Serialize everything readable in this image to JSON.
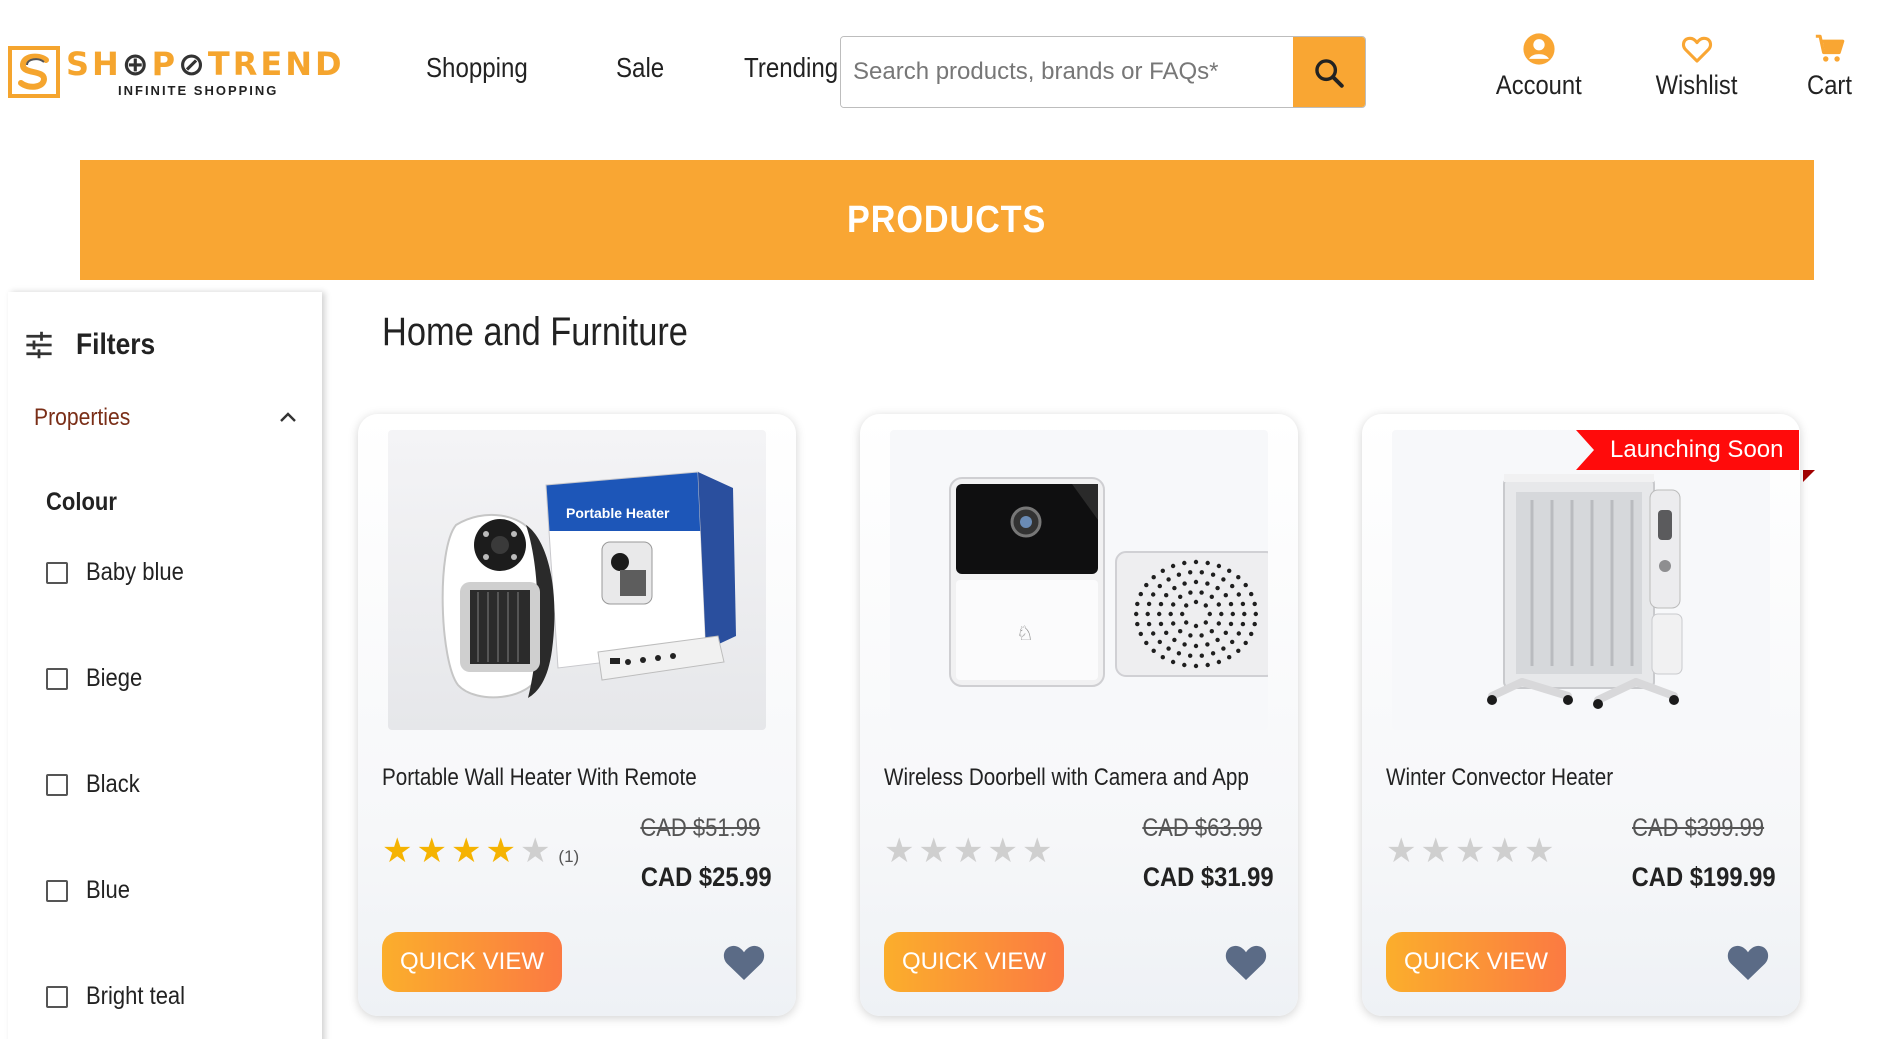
{
  "header": {
    "logo": {
      "name_left": "SH",
      "name_rest": "P",
      "name_mid": "T",
      "name_end": "REND",
      "tagline": "INFINITE SHOPPING"
    },
    "nav": [
      "Shopping",
      "Sale",
      "Trending"
    ],
    "search": {
      "placeholder": "Search products, brands or FAQs*",
      "icon": "search-icon"
    },
    "actions": {
      "account": "Account",
      "wishlist": "Wishlist",
      "cart": "Cart"
    }
  },
  "banner": {
    "title": "PRODUCTS"
  },
  "sidebar": {
    "title": "Filters",
    "properties_label": "Properties",
    "colour_title": "Colour",
    "colours": [
      "Baby blue",
      "Biege",
      "Black",
      "Blue",
      "Bright teal"
    ]
  },
  "main": {
    "section_title": "Home and Furniture",
    "products": [
      {
        "name": "Portable Wall Heater With Remote",
        "rating": 4,
        "reviews": "(1)",
        "old_price": "CAD  $51.99",
        "price": "CAD  $25.99",
        "button": "QUICK VIEW"
      },
      {
        "name": "Wireless Doorbell with Camera and App",
        "rating": 0,
        "reviews": "",
        "old_price": "CAD  $63.99",
        "price": "CAD  $31.99",
        "button": "QUICK VIEW"
      },
      {
        "name": "Winter Convector Heater",
        "rating": 0,
        "reviews": "",
        "old_price": "CAD  $399.99",
        "price": "CAD  $199.99",
        "button": "QUICK VIEW",
        "badge": "Launching Soon"
      }
    ]
  },
  "colors": {
    "accent": "#f9a633",
    "badge": "#ff0b0b",
    "star": "#f5b301",
    "heart": "#5b6b86",
    "properties": "#7a2e17"
  }
}
